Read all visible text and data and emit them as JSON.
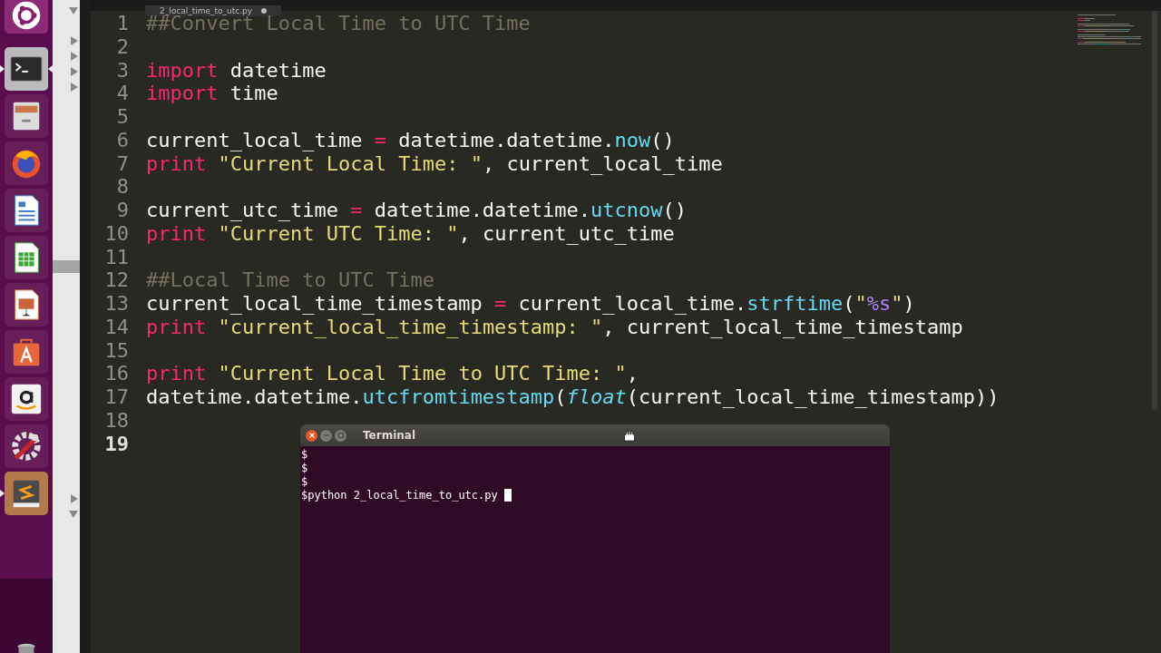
{
  "launcher": [
    {
      "kind": "ubuntu",
      "running": false,
      "active": false
    },
    {
      "kind": "terminal",
      "running": true,
      "active": true
    },
    {
      "kind": "files",
      "running": false,
      "active": false
    },
    {
      "kind": "firefox",
      "running": false,
      "active": false
    },
    {
      "kind": "writer",
      "running": false,
      "active": false
    },
    {
      "kind": "calc",
      "running": false,
      "active": false
    },
    {
      "kind": "impress",
      "running": false,
      "active": false
    },
    {
      "kind": "software",
      "running": false,
      "active": false
    },
    {
      "kind": "amazon",
      "running": false,
      "active": false
    },
    {
      "kind": "settings",
      "running": false,
      "active": false
    },
    {
      "kind": "sublime",
      "running": true,
      "active": false
    }
  ],
  "sidebar": {
    "tree_arrows": [
      {
        "expanded": true
      },
      {
        "expanded": false
      },
      {
        "expanded": false
      },
      {
        "expanded": false
      },
      {
        "expanded": false
      },
      {
        "expanded": false
      },
      {
        "expanded": true
      }
    ]
  },
  "editor": {
    "tab": {
      "title": "2_local_time_to_utc.py",
      "modified": true
    },
    "lines": [
      {
        "number": "1",
        "current": false,
        "tokens": [
          {
            "kind": "comment",
            "text": "##Convert Local Time to UTC Time"
          }
        ]
      },
      {
        "number": "2",
        "current": false
      },
      {
        "number": "3",
        "current": false,
        "tokens": [
          {
            "kind": "keyword",
            "text": "import"
          },
          {
            "kind": "plain",
            "text": " datetime"
          }
        ]
      },
      {
        "number": "4",
        "current": false,
        "tokens": [
          {
            "kind": "keyword",
            "text": "import"
          },
          {
            "kind": "plain",
            "text": " time"
          }
        ]
      },
      {
        "number": "5",
        "current": false
      },
      {
        "number": "6",
        "current": false,
        "tokens": [
          {
            "kind": "plain",
            "text": "current_local_time "
          },
          {
            "kind": "operator",
            "text": "="
          },
          {
            "kind": "plain",
            "text": " datetime.datetime."
          },
          {
            "kind": "function",
            "text": "now"
          },
          {
            "kind": "plain",
            "text": "()"
          }
        ]
      },
      {
        "number": "7",
        "current": false,
        "tokens": [
          {
            "kind": "keyword",
            "text": "print "
          },
          {
            "kind": "string",
            "text": "\"Current Local Time: \""
          },
          {
            "kind": "plain",
            "text": ", current_local_time"
          }
        ]
      },
      {
        "number": "8",
        "current": false
      },
      {
        "number": "9",
        "current": false,
        "tokens": [
          {
            "kind": "plain",
            "text": "current_utc_time "
          },
          {
            "kind": "operator",
            "text": "="
          },
          {
            "kind": "plain",
            "text": " datetime.datetime."
          },
          {
            "kind": "function",
            "text": "utcnow"
          },
          {
            "kind": "plain",
            "text": "()"
          }
        ]
      },
      {
        "number": "10",
        "current": false,
        "tokens": [
          {
            "kind": "keyword",
            "text": "print "
          },
          {
            "kind": "string",
            "text": "\"Current UTC Time: \""
          },
          {
            "kind": "plain",
            "text": ", current_utc_time"
          }
        ]
      },
      {
        "number": "11",
        "current": false
      },
      {
        "number": "12",
        "current": false,
        "tokens": [
          {
            "kind": "comment",
            "text": "##Local Time to UTC Time"
          }
        ]
      },
      {
        "number": "13",
        "current": false,
        "tokens": [
          {
            "kind": "plain",
            "text": "current_local_time_timestamp "
          },
          {
            "kind": "operator",
            "text": "="
          },
          {
            "kind": "plain",
            "text": " current_local_time."
          },
          {
            "kind": "function",
            "text": "strftime"
          },
          {
            "kind": "plain",
            "text": "("
          },
          {
            "kind": "string",
            "text": "\""
          },
          {
            "kind": "constant",
            "text": "%s"
          },
          {
            "kind": "string",
            "text": "\""
          },
          {
            "kind": "plain",
            "text": ")"
          }
        ]
      },
      {
        "number": "14",
        "current": false,
        "tokens": [
          {
            "kind": "keyword",
            "text": "print "
          },
          {
            "kind": "string",
            "text": "\"current_local_time_timestamp: \""
          },
          {
            "kind": "plain",
            "text": ", current_local_time_timestamp"
          }
        ]
      },
      {
        "number": "15",
        "current": false
      },
      {
        "number": "16",
        "current": false,
        "tokens": [
          {
            "kind": "keyword",
            "text": "print "
          },
          {
            "kind": "string",
            "text": "\"Current Local Time to UTC Time: \""
          },
          {
            "kind": "plain",
            "text": ","
          }
        ]
      },
      {
        "number": "17",
        "current": false,
        "tokens": [
          {
            "kind": "plain",
            "text": "datetime.datetime."
          },
          {
            "kind": "function",
            "text": "utcfromtimestamp"
          },
          {
            "kind": "plain",
            "text": "("
          },
          {
            "kind": "builtin",
            "text": "float"
          },
          {
            "kind": "plain",
            "text": "(current_local_time_timestamp))"
          }
        ]
      },
      {
        "number": "18",
        "current": false
      },
      {
        "number": "19",
        "current": true
      }
    ]
  },
  "terminal": {
    "title": "Terminal",
    "lines": [
      "$",
      "$",
      "$",
      "$python 2_local_time_to_utc.py"
    ]
  }
}
